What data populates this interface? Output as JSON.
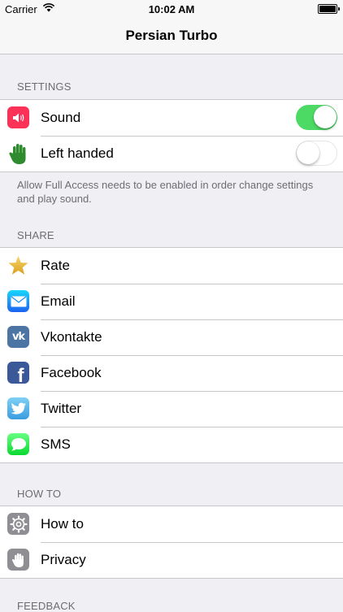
{
  "status_bar": {
    "carrier": "Carrier",
    "time": "10:02 AM"
  },
  "nav": {
    "title": "Persian Turbo"
  },
  "sections": {
    "settings": {
      "header": "SETTINGS",
      "sound": {
        "label": "Sound",
        "enabled": true,
        "icon": "speaker-icon"
      },
      "left_handed": {
        "label": "Left handed",
        "enabled": false,
        "icon": "hand-icon"
      },
      "note": "Allow Full Access needs to be enabled in order change settings and play sound."
    },
    "share": {
      "header": "SHARE",
      "items": [
        {
          "label": "Rate",
          "icon": "star-icon"
        },
        {
          "label": "Email",
          "icon": "mail-icon"
        },
        {
          "label": "Vkontakte",
          "icon": "vk-icon"
        },
        {
          "label": "Facebook",
          "icon": "facebook-icon"
        },
        {
          "label": "Twitter",
          "icon": "twitter-icon"
        },
        {
          "label": "SMS",
          "icon": "message-icon"
        }
      ]
    },
    "howto": {
      "header": "HOW TO",
      "items": [
        {
          "label": "How to",
          "icon": "gear-icon"
        },
        {
          "label": "Privacy",
          "icon": "hand-icon"
        }
      ]
    },
    "feedback": {
      "header": "FEEDBACK"
    }
  },
  "colors": {
    "toggle_on": "#4cd964",
    "sound_icon_bg": "#fc3158",
    "mail_icon_bg": "#1d8bf1",
    "vk_icon_bg": "#4c75a3",
    "facebook_icon_bg": "#3b5998",
    "twitter_icon_bg": "#55acee",
    "sms_icon_bg": "#4cd964",
    "settings_icon_bg": "#8e8e93",
    "hand_green": "#2e8b2e",
    "star_gold": "#e8b830"
  }
}
